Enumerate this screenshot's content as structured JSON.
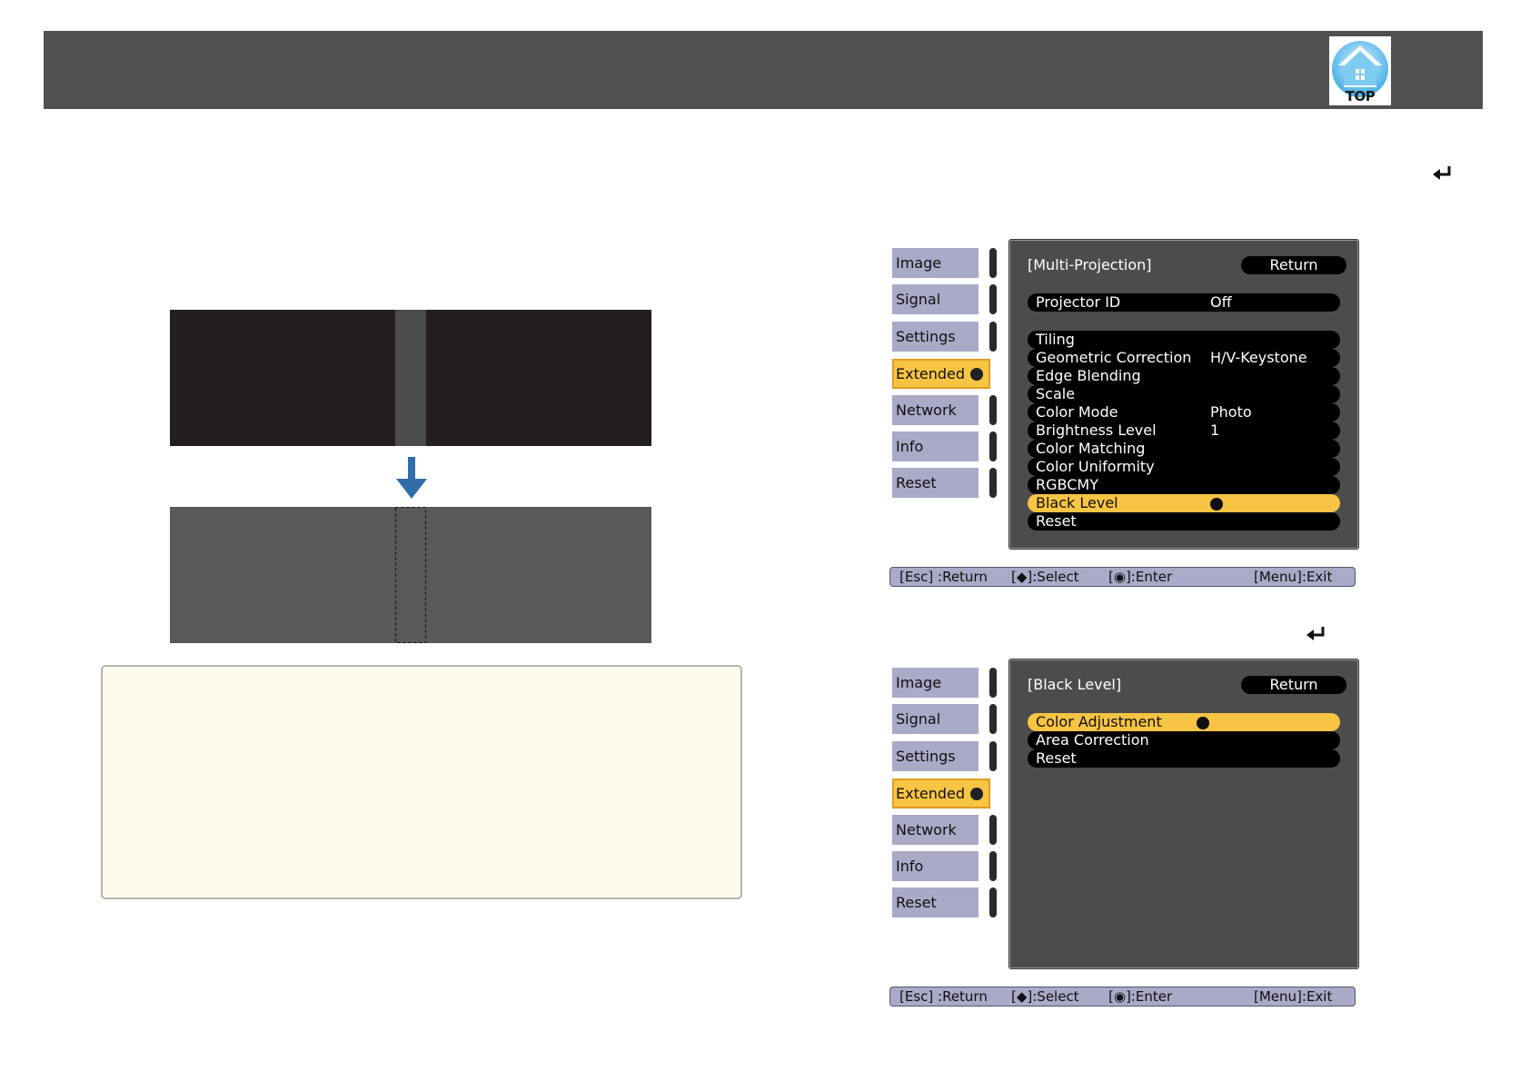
{
  "header": {
    "top_label": "TOP"
  },
  "osd1": {
    "sidebar": [
      "Image",
      "Signal",
      "Settings",
      "Extended",
      "Network",
      "Info",
      "Reset"
    ],
    "active_item": "Extended",
    "title": "[Multi-Projection]",
    "return_label": "Return",
    "projector_id": {
      "label": "Projector ID",
      "value": "Off"
    },
    "items": [
      {
        "label": "Tiling",
        "value": ""
      },
      {
        "label": "Geometric Correction",
        "value": "H/V-Keystone"
      },
      {
        "label": "Edge Blending",
        "value": ""
      },
      {
        "label": "Scale",
        "value": ""
      },
      {
        "label": "Color Mode",
        "value": "Photo"
      },
      {
        "label": "Brightness Level",
        "value": "1"
      },
      {
        "label": "Color Matching",
        "value": ""
      },
      {
        "label": "Color Uniformity",
        "value": ""
      },
      {
        "label": "RGBCMY",
        "value": ""
      },
      {
        "label": "Black Level",
        "value": ""
      },
      {
        "label": "Reset",
        "value": ""
      }
    ],
    "selected_item": "Black Level",
    "footer": {
      "esc": "[Esc] :Return",
      "select": "[◆]:Select",
      "enter": "[◉]:Enter",
      "exit": "[Menu]:Exit"
    }
  },
  "osd2": {
    "sidebar": [
      "Image",
      "Signal",
      "Settings",
      "Extended",
      "Network",
      "Info",
      "Reset"
    ],
    "active_item": "Extended",
    "title": "[Black Level]",
    "return_label": "Return",
    "items": [
      {
        "label": "Color Adjustment"
      },
      {
        "label": "Area Correction"
      },
      {
        "label": "Reset"
      }
    ],
    "selected_item": "Color Adjustment",
    "footer": {
      "esc": "[Esc] :Return",
      "select": "[◆]:Select",
      "enter": "[◉]:Enter",
      "exit": "[Menu]:Exit"
    }
  },
  "colors": {
    "header": "#505050",
    "menu_side": "#a9a9c8",
    "menu_active": "#f7c443",
    "menu_panel": "#4c4c4c",
    "note_bg": "#fdfbe9",
    "arrow": "#2f6eaa"
  }
}
